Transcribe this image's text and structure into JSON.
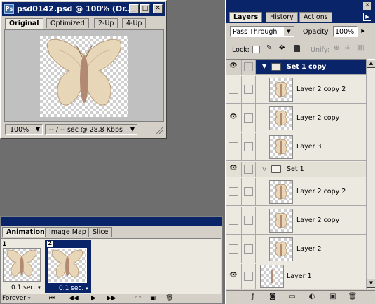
{
  "document_window": {
    "title": "psd0142.psd @ 100% (Or...",
    "tabs": [
      "Original",
      "Optimized",
      "2-Up",
      "4-Up"
    ],
    "zoom": "100%",
    "status": "-- / -- sec @ 28.8 Kbps"
  },
  "animation_palette": {
    "tabs": [
      "Animation",
      "Image Map",
      "Slice"
    ],
    "frames": [
      {
        "number": "1",
        "delay": "0.1 sec."
      },
      {
        "number": "2",
        "delay": "0.1 sec."
      }
    ],
    "loop": "Forever"
  },
  "layers_palette": {
    "tabs": [
      "Layers",
      "History",
      "Actions"
    ],
    "blend_mode": "Pass Through",
    "opacity_label": "Opacity:",
    "opacity_value": "100%",
    "lock_label": "Lock:",
    "unify_label": "Unify:",
    "layers": [
      {
        "name": "Set 1 copy",
        "type": "set",
        "expanded": true,
        "visible": true,
        "selected": true
      },
      {
        "name": "Layer 2 copy 2",
        "type": "layer",
        "visible": false
      },
      {
        "name": "Layer 2 copy",
        "type": "layer",
        "visible": true
      },
      {
        "name": "Layer 3",
        "type": "layer",
        "visible": false
      },
      {
        "name": "Set 1",
        "type": "set",
        "expanded": true,
        "visible": true
      },
      {
        "name": "Layer 2 copy 2",
        "type": "layer",
        "visible": false
      },
      {
        "name": "Layer 2 copy",
        "type": "layer",
        "visible": false
      },
      {
        "name": "Layer 2",
        "type": "layer",
        "visible": false
      },
      {
        "name": "Layer 1",
        "type": "layer",
        "visible": true
      }
    ]
  },
  "colors": {
    "title_bar": "#0a246a",
    "selection": "#0a246a",
    "panel": "#d4d0c8"
  }
}
